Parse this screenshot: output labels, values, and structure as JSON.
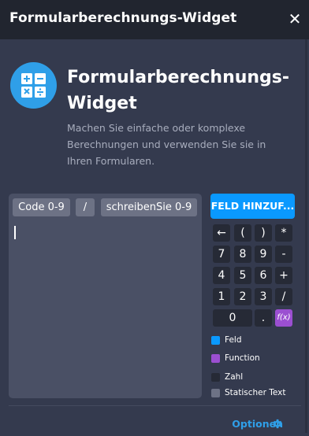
{
  "header": {
    "title": "Formularberechnungs-Widget",
    "close_label": "✕"
  },
  "widget": {
    "title": "Formularberechnungs-Widget",
    "description": "Machen Sie einfache oder komplexe Berechnungen und verwenden Sie sie in Ihren Formularen.",
    "icon": "calculator-icon"
  },
  "editor": {
    "chips": [
      "Code 0-9",
      "/",
      "schreibenSie 0-9"
    ]
  },
  "add_field_button": "FELD HINZUF...",
  "keypad": {
    "row1": [
      "←",
      "(",
      ")",
      "*"
    ],
    "row2": [
      "7",
      "8",
      "9",
      "-"
    ],
    "row3": [
      "4",
      "5",
      "6",
      "+"
    ],
    "row4": [
      "1",
      "2",
      "3",
      "/"
    ],
    "row5": [
      "0",
      ".",
      "f(x)"
    ]
  },
  "legend": [
    {
      "label": "Feld",
      "color": "#0a99ff"
    },
    {
      "label": "Function",
      "color": "#9b4fd1"
    },
    {
      "label": "Zahl",
      "color": "#262a36"
    },
    {
      "label": "Statischer Text",
      "color": "#6d7285"
    }
  ],
  "footer": {
    "options_label": "Optionen",
    "options_icon": "gear-icon"
  },
  "colors": {
    "background": "#343a4e",
    "header": "#21252f",
    "accent": "#0a99ff",
    "function": "#9b4fd1"
  }
}
